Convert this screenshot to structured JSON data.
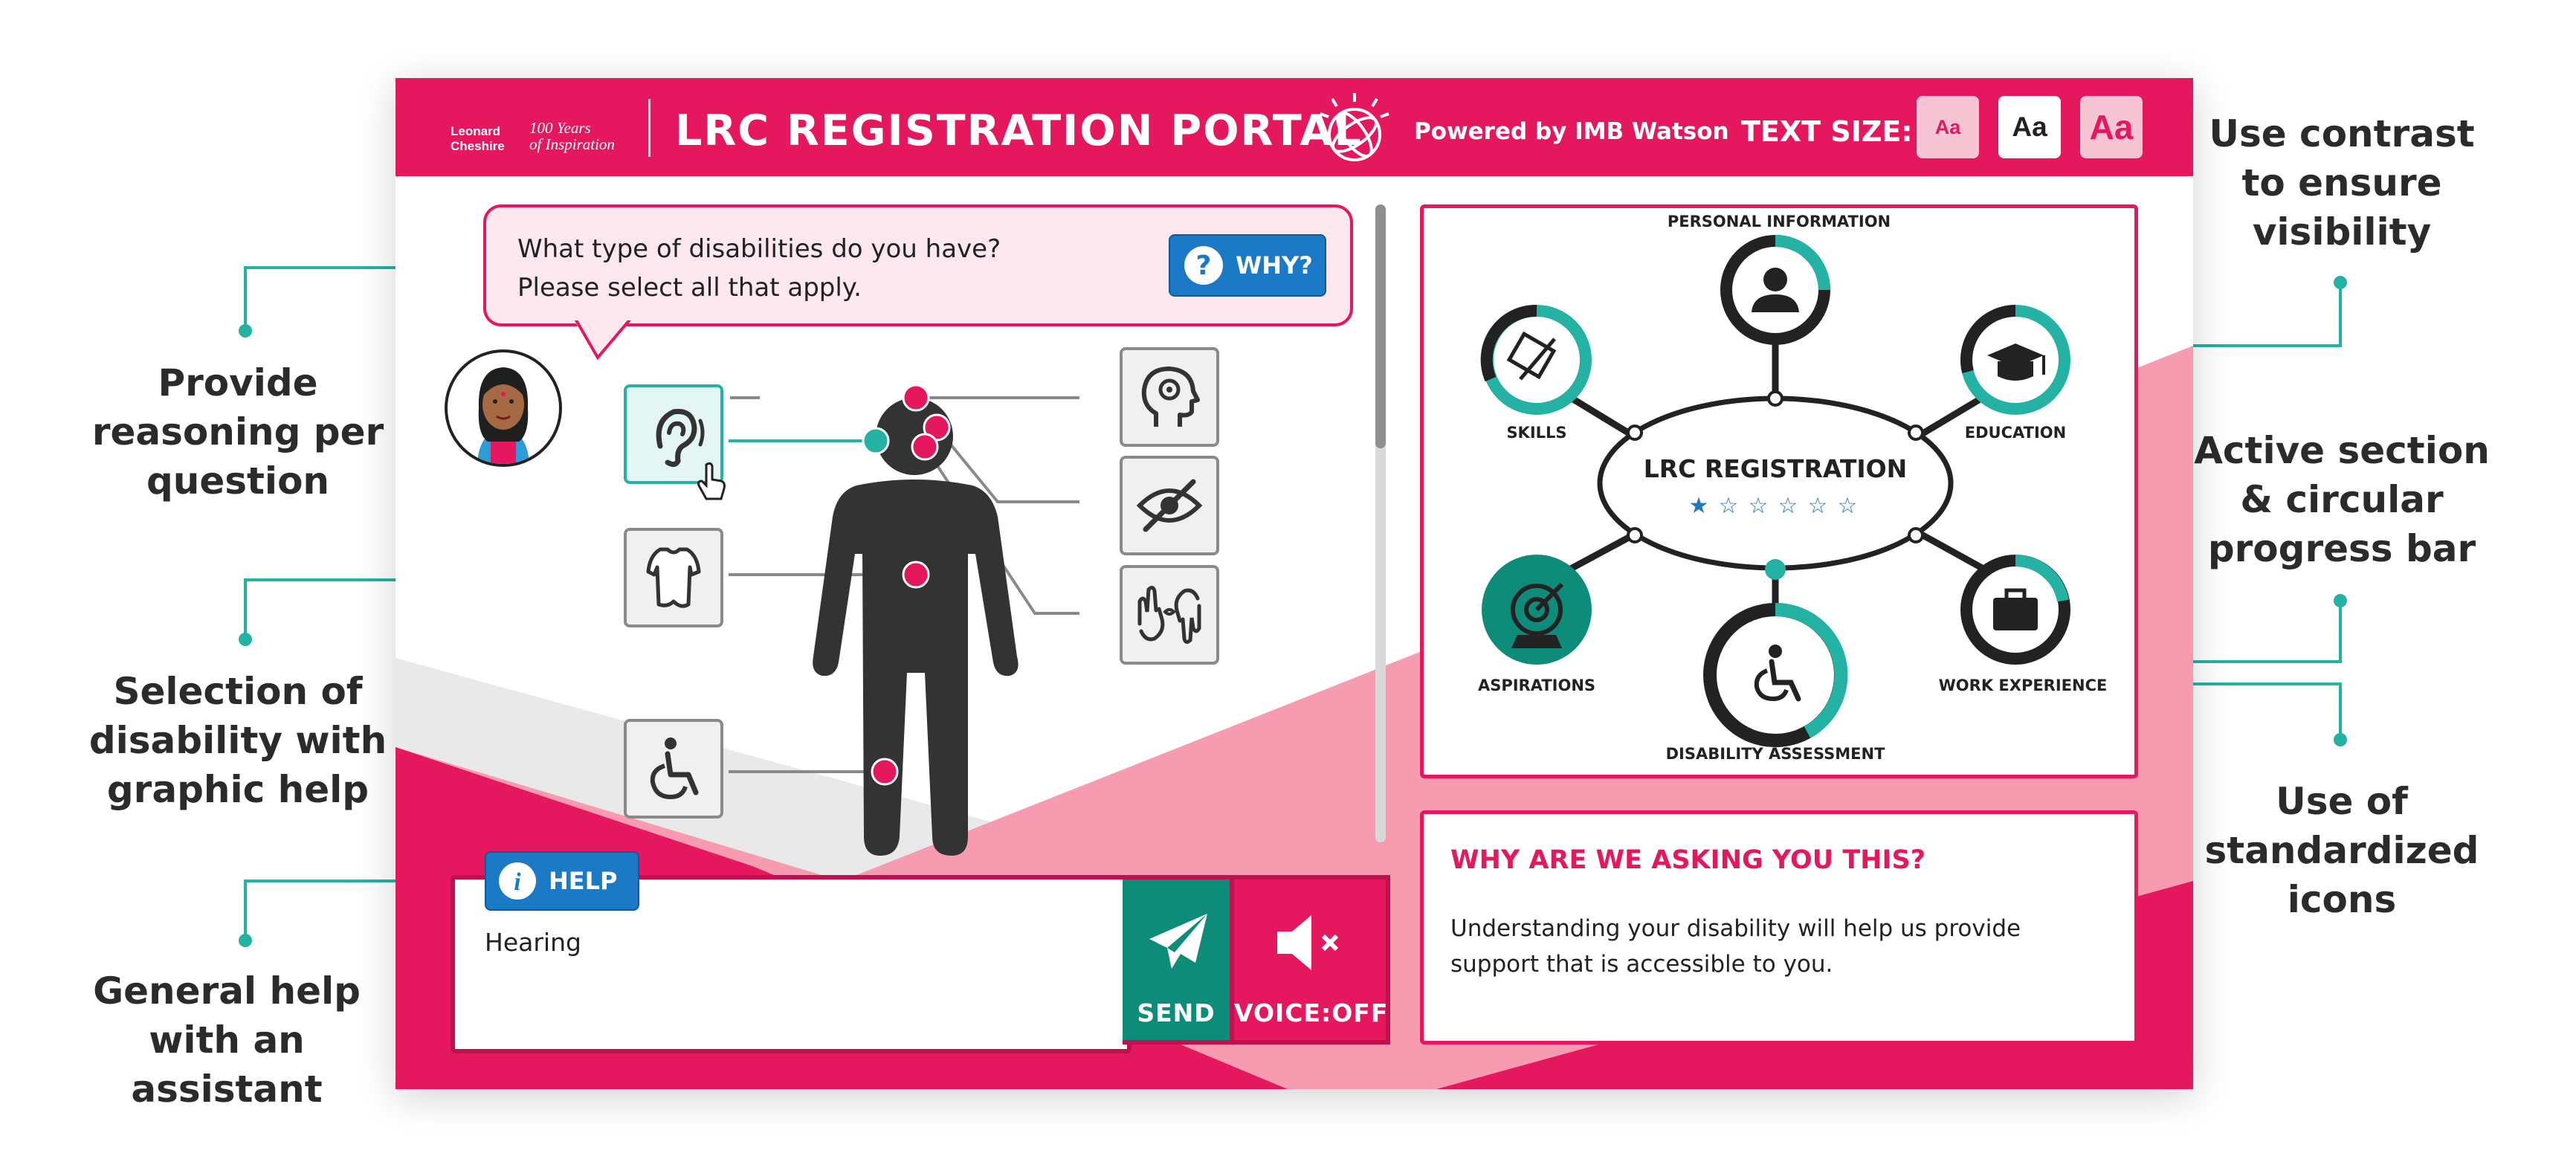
{
  "header": {
    "brand_line1": "Leonard",
    "brand_line2": "Cheshire",
    "brand_tagline1": "100 Years",
    "brand_tagline2": "of Inspiration",
    "title": "LRC REGISTRATION PORTAL",
    "powered_by": "Powered by IMB Watson",
    "text_size_label": "TEXT SIZE:",
    "text_size_options": [
      "Aa",
      "Aa",
      "Aa"
    ]
  },
  "question": {
    "text": "What type of disabilities do you have? Please select all that apply.",
    "why_label": "WHY?"
  },
  "input": {
    "help_label": "HELP",
    "value": "Hearing",
    "send_label": "SEND",
    "voice_label": "VOICE:OFF"
  },
  "progress_map": {
    "center_title": "LRC REGISTRATION",
    "rating": {
      "filled": 1,
      "total": 6
    },
    "nodes": {
      "personal": "PERSONAL INFORMATION",
      "skills": "SKILLS",
      "education": "EDUCATION",
      "aspirations": "ASPIRATIONS",
      "work": "WORK EXPERIENCE",
      "disability": "DISABILITY ASSESSMENT"
    }
  },
  "why_panel": {
    "title": "WHY ARE WE ASKING YOU THIS?",
    "body": "Understanding your disability will help us provide support that is accessible to you."
  },
  "annotations": {
    "reasoning": [
      "Provide",
      "reasoning per",
      "question"
    ],
    "selection": [
      "Selection of",
      "disability with",
      "graphic help"
    ],
    "general_help": [
      "General help",
      "with an assistant"
    ],
    "contrast": [
      "Use contrast",
      "to ensure",
      "visibility"
    ],
    "active_section": [
      "Active section",
      "& circular",
      "progress bar"
    ],
    "icons": [
      "Use of",
      "standardized",
      "icons"
    ]
  },
  "colors": {
    "brand": "#e5175f",
    "accent": "#23b2a4",
    "button_blue": "#1b79c6",
    "send_green": "#0e8c7a"
  }
}
